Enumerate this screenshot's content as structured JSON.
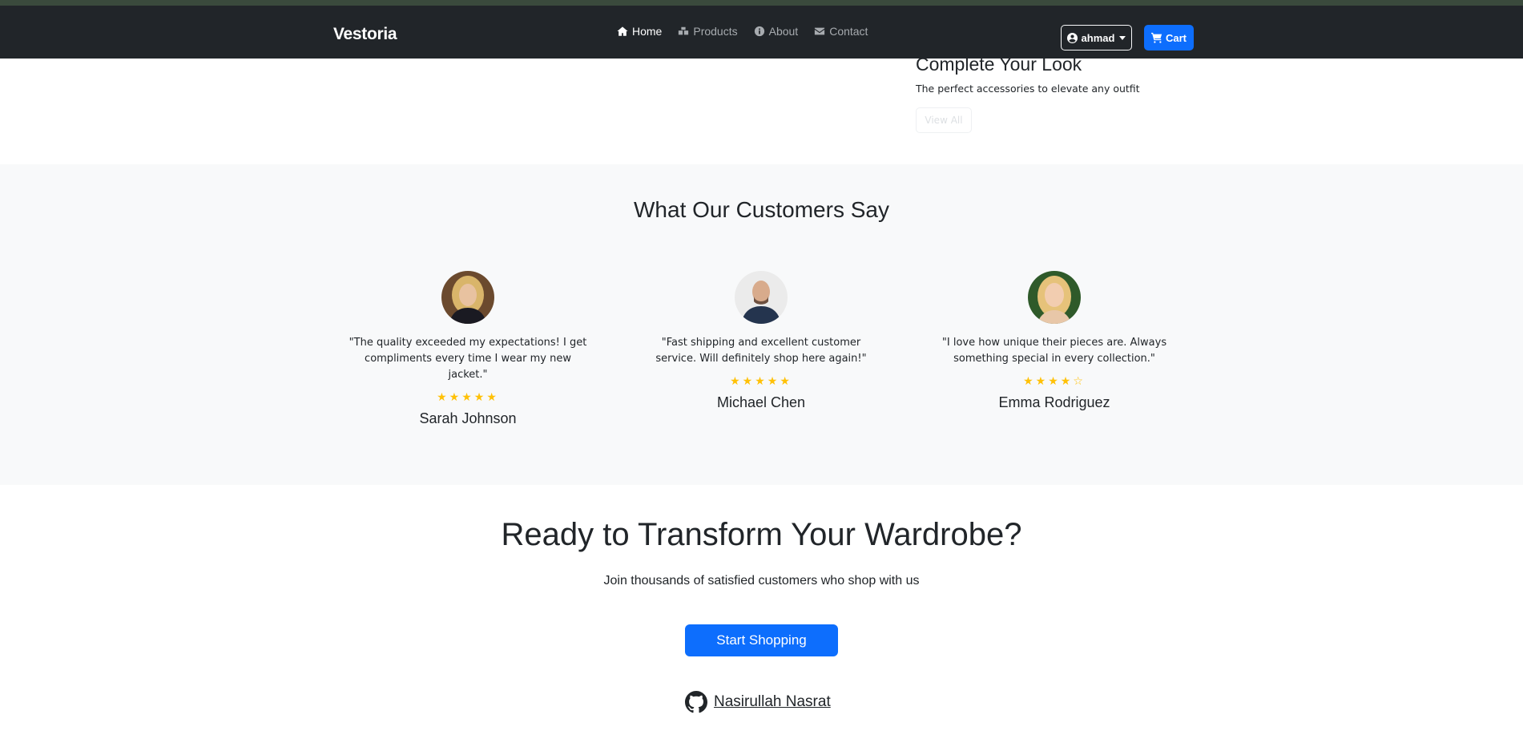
{
  "navbar": {
    "brand": "Vestoria",
    "links": [
      {
        "label": "Home",
        "icon": "home-icon",
        "active": true
      },
      {
        "label": "Products",
        "icon": "boxes-icon",
        "active": false
      },
      {
        "label": "About",
        "icon": "info-icon",
        "active": false
      },
      {
        "label": "Contact",
        "icon": "envelope-icon",
        "active": false
      }
    ],
    "user": {
      "label": "ahmad",
      "icon": "user-circle-icon"
    },
    "cart": {
      "label": "Cart",
      "icon": "cart-icon"
    }
  },
  "look": {
    "title": "Complete Your Look",
    "subtitle": "The perfect accessories to elevate any outfit",
    "button": "View All"
  },
  "testimonials": {
    "title": "What Our Customers Say",
    "items": [
      {
        "quote": "\"The quality exceeded my expectations! I get compliments every time I wear my new jacket.\"",
        "stars": "★★★★★",
        "rating": 5,
        "name": "Sarah Johnson"
      },
      {
        "quote": "\"Fast shipping and excellent customer service. Will definitely shop here again!\"",
        "stars": "★★★★★",
        "rating": 5,
        "name": "Michael Chen"
      },
      {
        "quote": "\"I love how unique their pieces are. Always something special in every collection.\"",
        "stars": "★★★★☆",
        "rating": 4,
        "name": "Emma Rodriguez"
      }
    ]
  },
  "cta": {
    "title": "Ready to Transform Your Wardrobe?",
    "subtitle": "Join thousands of satisfied customers who shop with us",
    "button": "Start Shopping"
  },
  "footer": {
    "github_label": " Nasirullah Nasrat",
    "icon": "github-icon"
  },
  "colors": {
    "navbar_bg": "#212529",
    "primary": "#0d6efd",
    "star": "#ffc107",
    "section_bg": "#f8f9fa"
  }
}
